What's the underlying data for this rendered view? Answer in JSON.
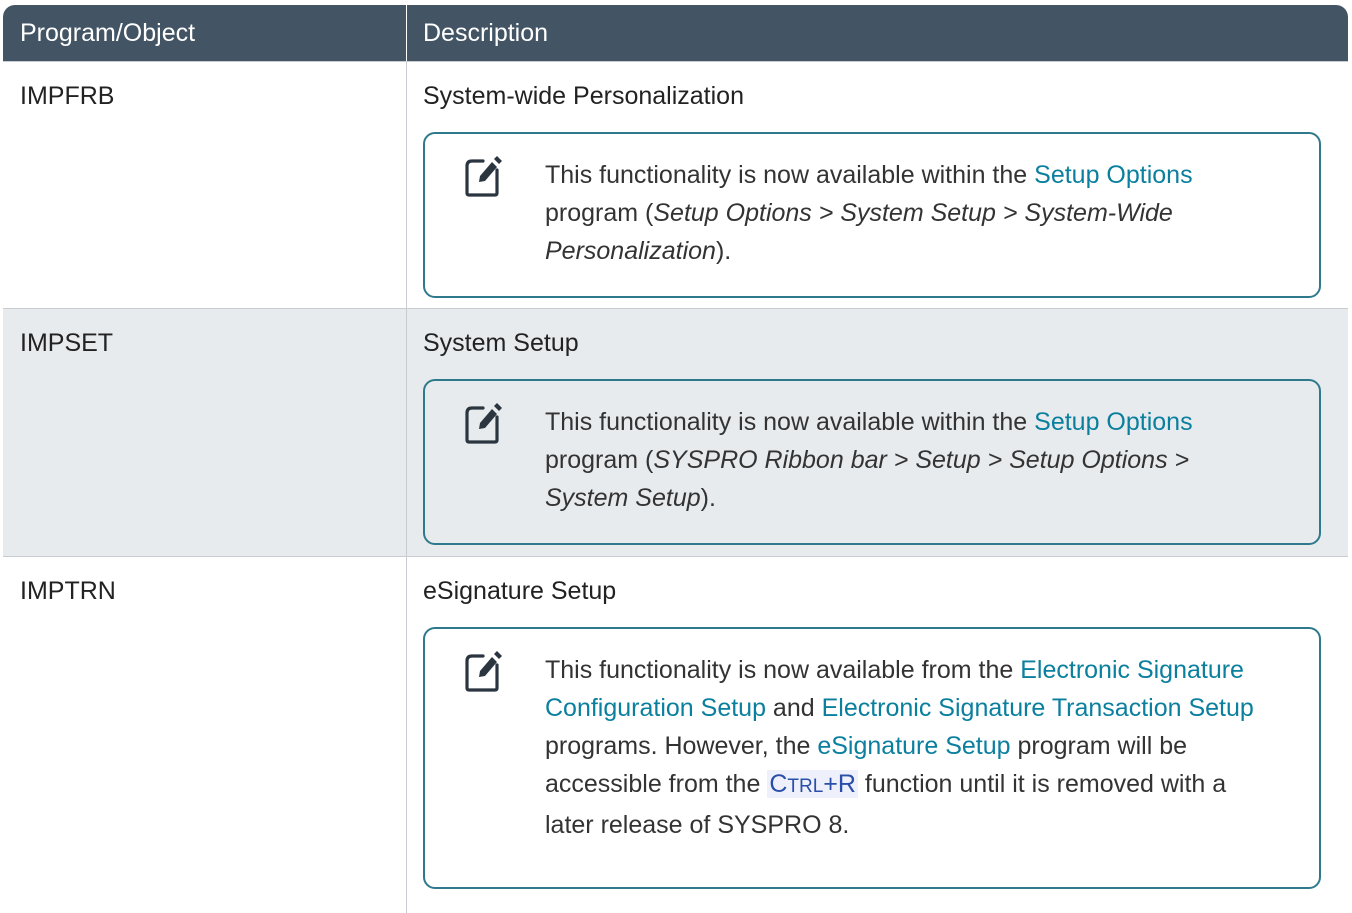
{
  "header": {
    "col1": "Program/Object",
    "col2": "Description"
  },
  "rows": [
    {
      "program": "IMPFRB",
      "title": "System-wide Personalization",
      "note": {
        "icon": "note-icon",
        "pre": "This functionality is now available within the ",
        "link": "Setup Options",
        "mid": " program (",
        "path": "Setup Options > System Setup > System-Wide Personalization",
        "post": ")."
      }
    },
    {
      "program": "IMPSET",
      "title": "System Setup",
      "note": {
        "icon": "note-icon",
        "pre": "This functionality is now available within the ",
        "link": "Setup Options",
        "mid": " program (",
        "path": "SYSPRO Ribbon bar > Setup > Setup Options > System Setup",
        "post": ")."
      }
    },
    {
      "program": "IMPTRN",
      "title": "eSignature Setup",
      "note": {
        "icon": "note-icon",
        "pre": "This functionality is now available from the ",
        "link1": "Electronic Signature Configuration Setup",
        "and": " and ",
        "link2": "Electronic Signature Transaction Setup",
        "mid": " programs. However, the ",
        "link3": "eSignature Setup",
        "mid2": " program will be accessible from the ",
        "key_c": "C",
        "key_rest": "TRL",
        "key_plus": "+R",
        "post": " function until it is removed with a later release of SYSPRO 8."
      }
    }
  ],
  "colors": {
    "header_bg": "#435565",
    "link": "#0b7f9e",
    "note_border": "#2e7a8c",
    "alt_row": "#e8ebee"
  }
}
